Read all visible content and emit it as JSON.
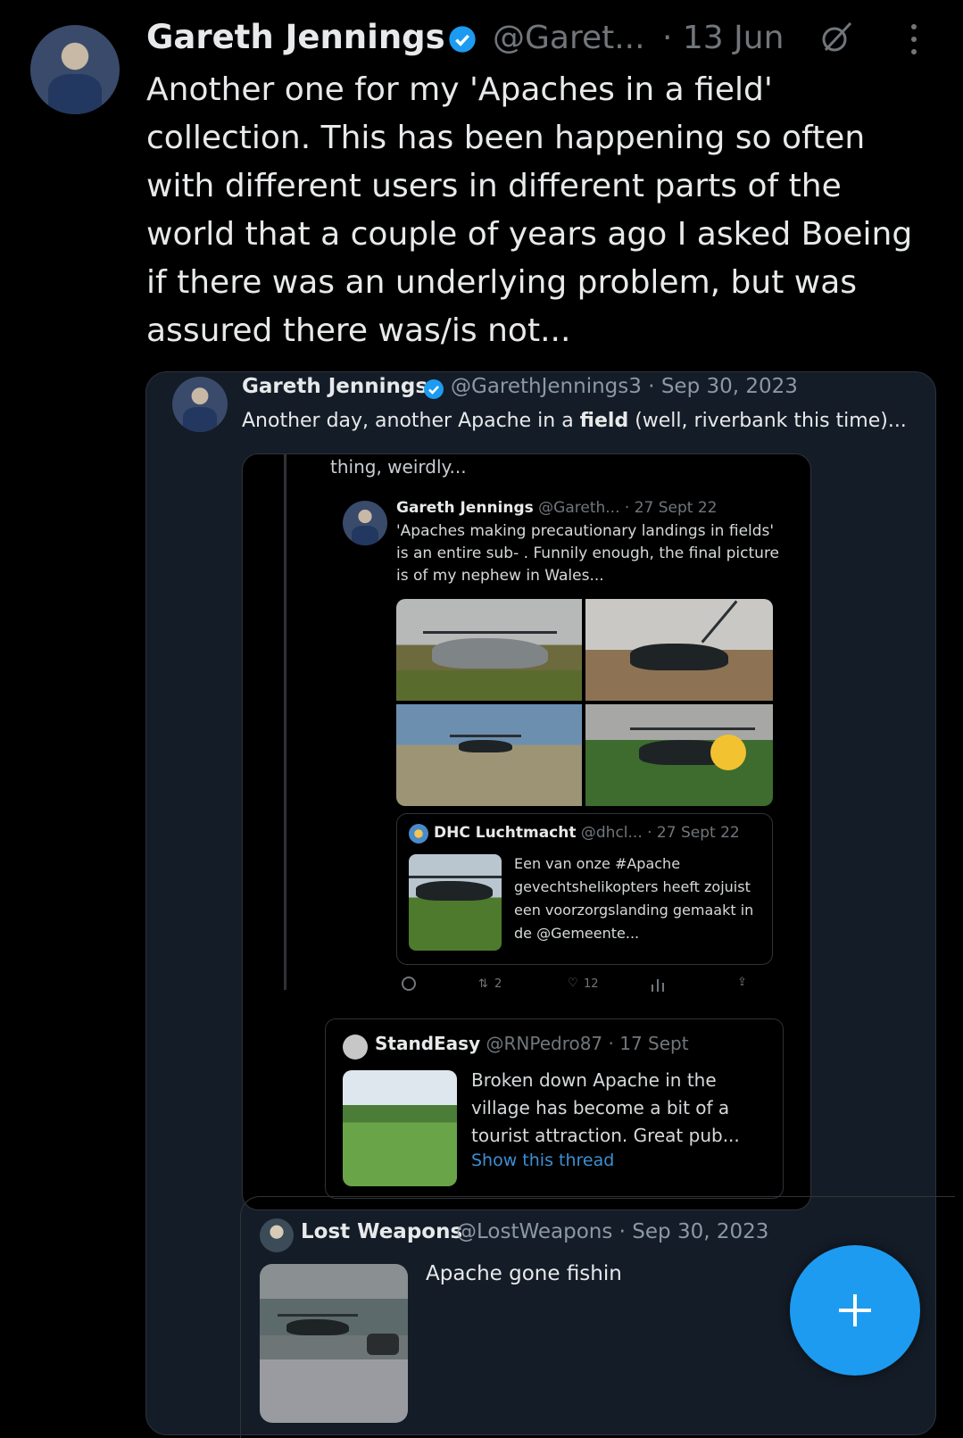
{
  "main_post": {
    "author_name": "Gareth Jennings",
    "handle": "@Garet...",
    "date": "· 13 Jun",
    "text": "Another one for my 'Apaches in a field' collection. This has been happening so often with different users in different parts of the world that a couple of years ago I asked Boeing if there was an underlying problem, but was assured there was/is not..."
  },
  "quoted_post": {
    "author_name": "Gareth Jennings",
    "handle_date": "@GarethJennings3 · Sep 30, 2023",
    "text_before": "Another day, another Apache in a ",
    "text_bold": "field",
    "text_after": " (well, riverbank this time)..."
  },
  "embedded_screenshot": {
    "top_text": "thing, weirdly...",
    "post": {
      "author_name": "Gareth Jennings",
      "meta": " @Gareth... · 27 Sept 22",
      "text": "'Apaches making precautionary landings in fields' is an entire sub-     . Funnily enough, the final picture is of my nephew in Wales..."
    },
    "dhc": {
      "author_name": "DHC Luchtmacht",
      "meta": " @dhcl... · 27 Sept 22",
      "text": "Een van onze #Apache gevechtshelikopters heeft zojuist een voorzorgslanding gemaakt in de @Gemeente..."
    },
    "actions": {
      "retweets": "2",
      "likes": "12"
    },
    "standeasy": {
      "author_name": "StandEasy",
      "meta": " @RNPedro87 · 17 Sept",
      "text": "Broken down Apache in the village has become a bit of a tourist attraction. Great pub...",
      "link": "Show this thread"
    }
  },
  "nested_quote": {
    "author_name": "Lost Weapons",
    "handle_date": "@LostWeapons · Sep 30, 2023",
    "text": "Apache gone fishin"
  },
  "colors": {
    "accent": "#1d9bf0",
    "background": "#000000",
    "card": "#141c27",
    "muted": "#71767b"
  }
}
